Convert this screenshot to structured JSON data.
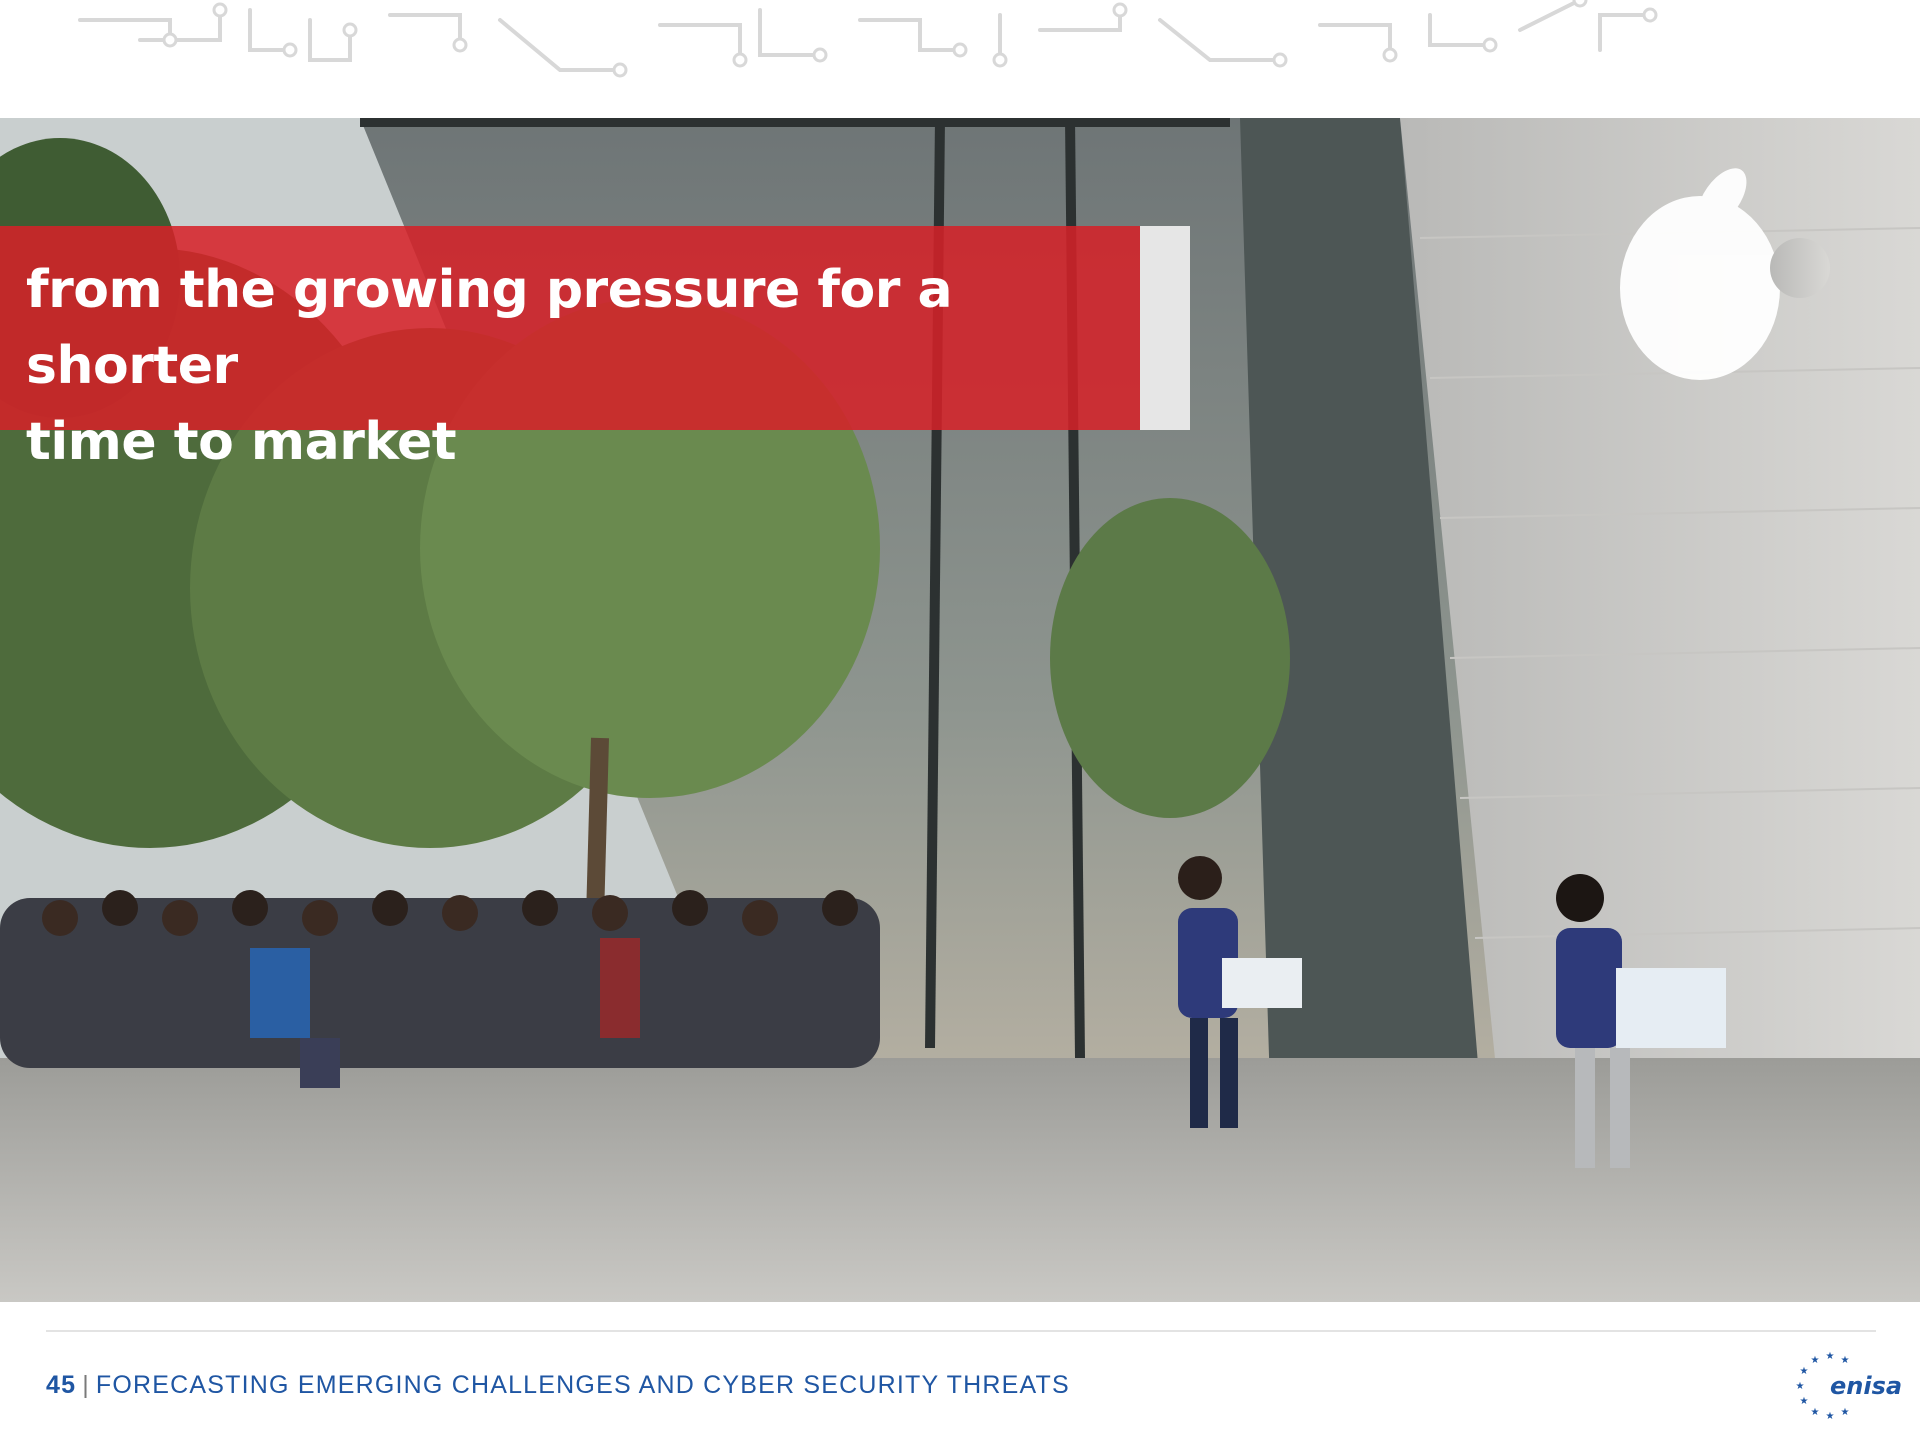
{
  "slide": {
    "caption_lines": [
      "from the growing pressure for a shorter",
      "time to market"
    ],
    "footer": {
      "page_number": "45",
      "separator": "|",
      "title": "FORECASTING EMERGING CHALLENGES AND CYBER SECURITY THREATS"
    },
    "logo": {
      "word": "enisa",
      "icon": "eu-stars-icon"
    },
    "photo": {
      "icon": "crowd-queue-photo"
    },
    "colors": {
      "banner_red": "#d62128",
      "footer_blue": "#1f56a3",
      "circuit_grey": "#d8d8d8"
    }
  }
}
